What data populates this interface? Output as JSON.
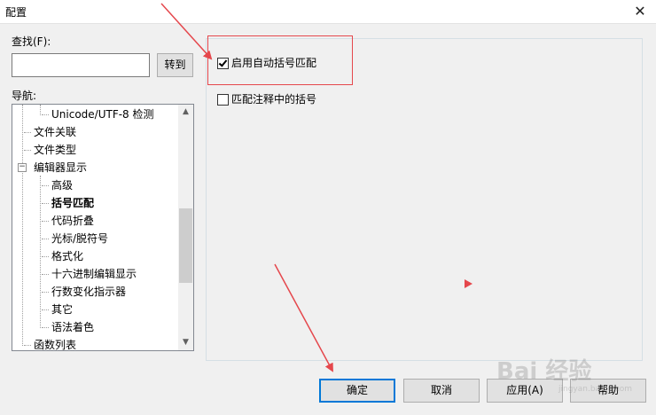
{
  "window": {
    "title": "配置",
    "close_glyph": "✕"
  },
  "search": {
    "label": "查找(F):",
    "value": "",
    "placeholder": "",
    "goto_label": "转到"
  },
  "nav": {
    "label": "导航:",
    "items": [
      {
        "label": "Unicode/UTF-8 检测",
        "level": 2,
        "selected": false
      },
      {
        "label": "文件关联",
        "level": 1,
        "selected": false
      },
      {
        "label": "文件类型",
        "level": 1,
        "selected": false
      },
      {
        "label": "编辑器显示",
        "level": 1,
        "selected": false,
        "expanded": true,
        "expander_glyph": "−"
      },
      {
        "label": "高级",
        "level": 2,
        "selected": false
      },
      {
        "label": "括号匹配",
        "level": 2,
        "selected": true
      },
      {
        "label": "代码折叠",
        "level": 2,
        "selected": false
      },
      {
        "label": "光标/脱符号",
        "level": 2,
        "selected": false
      },
      {
        "label": "格式化",
        "level": 2,
        "selected": false
      },
      {
        "label": "十六进制编辑显示",
        "level": 2,
        "selected": false
      },
      {
        "label": "行数变化指示器",
        "level": 2,
        "selected": false
      },
      {
        "label": "其它",
        "level": 2,
        "selected": false
      },
      {
        "label": "语法着色",
        "level": 2,
        "selected": false
      },
      {
        "label": "函数列表",
        "level": 1,
        "selected": false
      }
    ],
    "scroll_up_glyph": "▲",
    "scroll_down_glyph": "▼"
  },
  "options": {
    "auto_brace_match": {
      "label": "启用自动括号匹配",
      "checked": true
    },
    "match_in_comments": {
      "label": "匹配注释中的括号",
      "checked": false
    }
  },
  "buttons": {
    "ok": "确定",
    "cancel": "取消",
    "apply": "应用(A)",
    "help": "帮助"
  },
  "colors": {
    "annotation_red": "#e5474c"
  },
  "watermark": {
    "text": "Bai 经验",
    "sub": "jingyan.baidu.com"
  }
}
